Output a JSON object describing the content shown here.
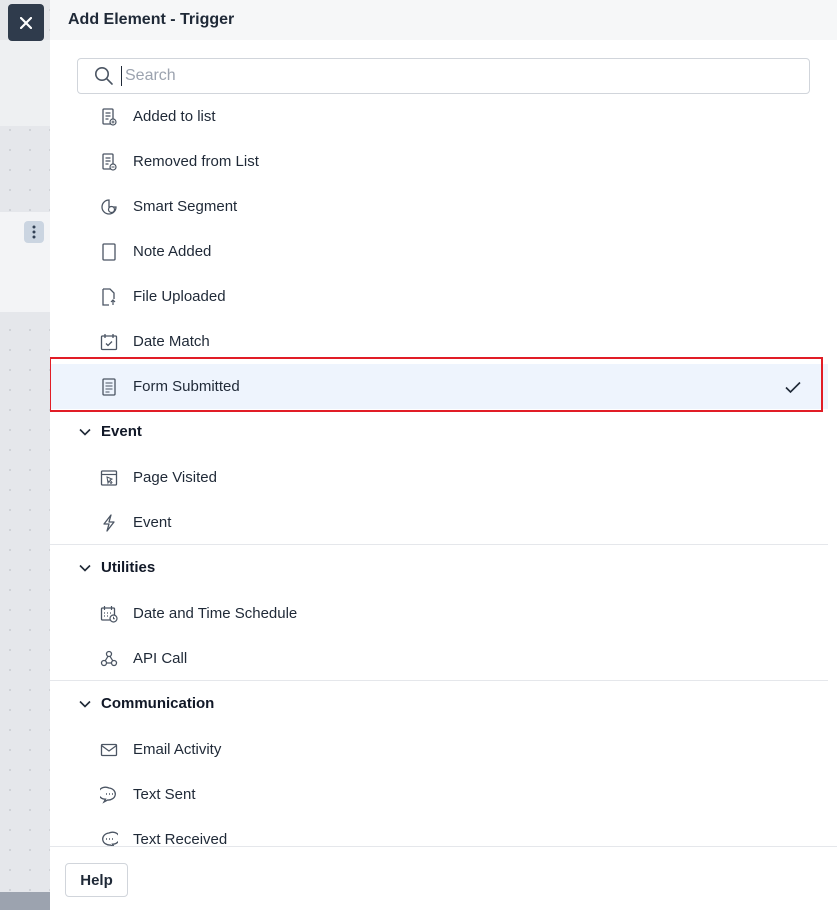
{
  "panel": {
    "title": "Add Element - Trigger",
    "search_placeholder": "Search",
    "search_value": ""
  },
  "items": [
    {
      "label": "Added to list",
      "icon": "list-add-icon"
    },
    {
      "label": "Removed from List",
      "icon": "list-remove-icon"
    },
    {
      "label": "Smart Segment",
      "icon": "smart-segment-icon"
    },
    {
      "label": "Note Added",
      "icon": "note-icon"
    },
    {
      "label": "File Uploaded",
      "icon": "file-upload-icon"
    },
    {
      "label": "Date Match",
      "icon": "calendar-check-icon"
    },
    {
      "label": "Form Submitted",
      "icon": "form-icon",
      "selected": true
    }
  ],
  "groups": {
    "event": {
      "label": "Event",
      "items": [
        {
          "label": "Page Visited",
          "icon": "page-visit-icon"
        },
        {
          "label": "Event",
          "icon": "lightning-icon"
        }
      ]
    },
    "utilities": {
      "label": "Utilities",
      "items": [
        {
          "label": "Date and Time Schedule",
          "icon": "calendar-clock-icon"
        },
        {
          "label": "API Call",
          "icon": "webhook-icon"
        }
      ]
    },
    "communication": {
      "label": "Communication",
      "items": [
        {
          "label": "Email Activity",
          "icon": "envelope-icon"
        },
        {
          "label": "Text Sent",
          "icon": "chat-sent-icon"
        },
        {
          "label": "Text Received",
          "icon": "chat-received-icon"
        }
      ]
    }
  },
  "footer": {
    "help_label": "Help"
  },
  "colors": {
    "selected_bg": "#eef4fd",
    "highlight_border": "#e11d26",
    "close_bg": "#2f3b4c"
  }
}
